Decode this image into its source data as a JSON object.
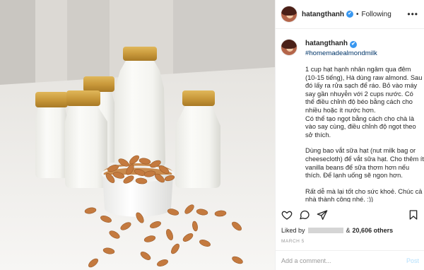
{
  "post": {
    "username": "hatangthanh",
    "verified_icon": "✔",
    "follow_label": "Following",
    "more_icon": "•••",
    "caption": {
      "username": "hatangthanh",
      "hashtag": "#homemadealmondmilk",
      "paragraphs": [
        "1 cup hạt hạnh nhân ngâm qua đêm (10-15 tiếng), Hà dùng raw almond. Sau đó lấy ra rửa sạch để ráo. Bỏ vào máy say gần nhuyễn với 2 cups nước. Có thể điều chỉnh độ béo bằng cách cho nhiều hoặc ít nước hơn.",
        "Có thể tạo ngọt bằng cách cho chà là vào say cùng, điều chỉnh độ ngọt theo sở thích.",
        "Dùng bao vắt sữa hạt (nut milk bag or cheesecloth) để vắt sữa hạt. Cho thêm ít vanilla beans để sữa thơm hơn nếu thích. Để lạnh uống sẽ ngon hơn.",
        "Rất dễ mà lại tốt cho sức khoẻ. Chúc cả nhà thành công nhé. :))"
      ]
    },
    "actions": {
      "like_icon": "heart-icon",
      "comment_icon": "comment-icon",
      "share_icon": "share-icon",
      "save_icon": "bookmark-icon"
    },
    "likes": {
      "prefix": "Liked by",
      "connector": "&",
      "count": "20,606 others"
    },
    "date": "MARCH 5",
    "comment_box": {
      "placeholder": "Add a comment...",
      "post_label": "Post"
    },
    "colors": {
      "link": "#003569",
      "verified": "#3897f0",
      "post_disabled": "#b2dffc",
      "muted": "#999999",
      "cap_gold": "#c79a3c",
      "almond": "#c47a3f"
    }
  }
}
